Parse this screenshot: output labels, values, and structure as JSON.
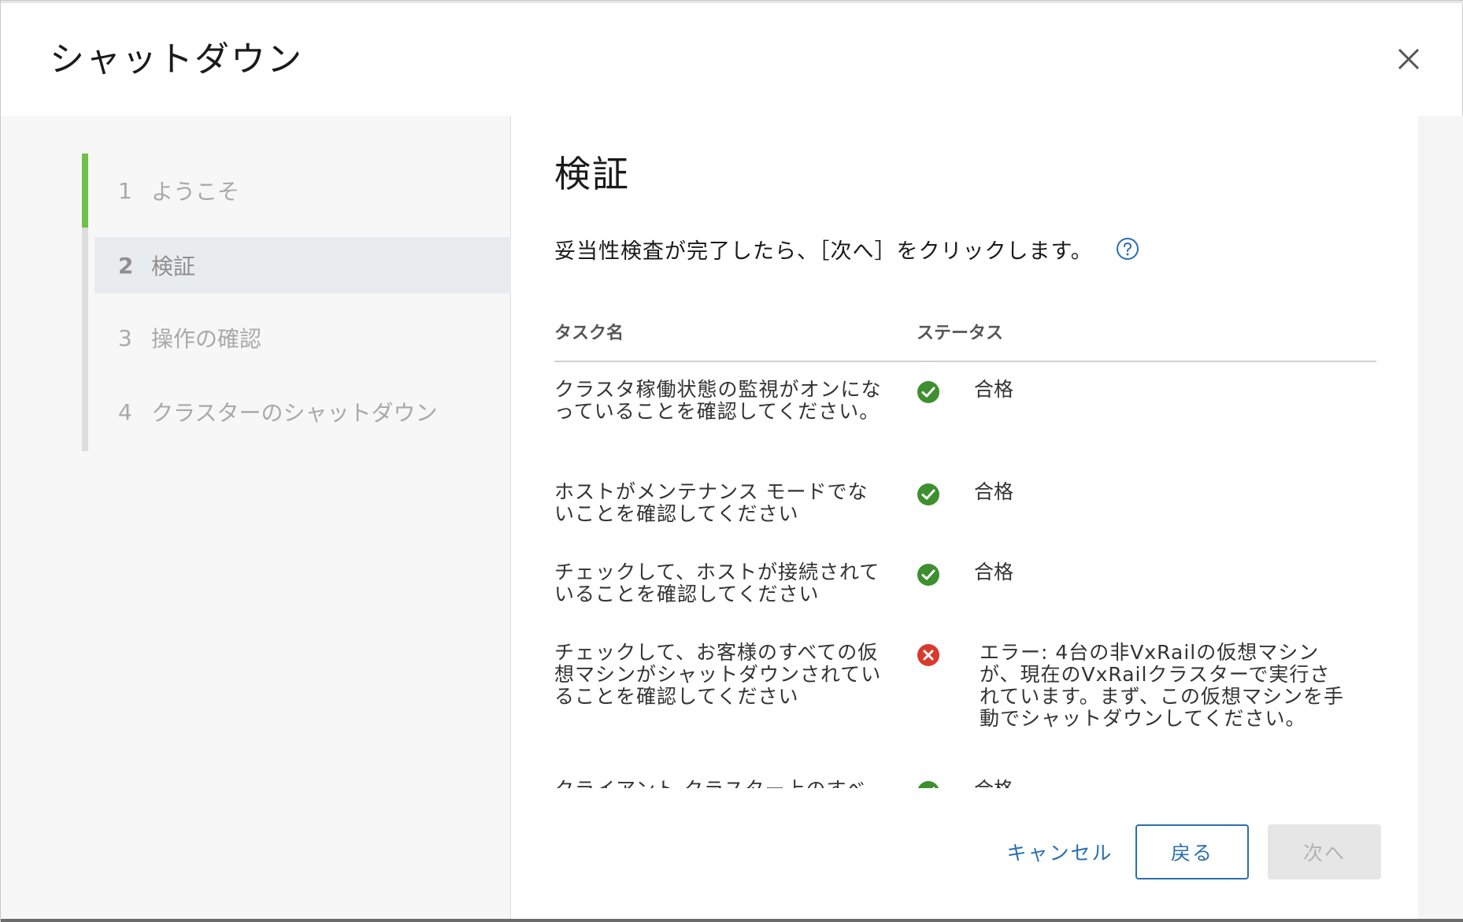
{
  "dialog": {
    "title": "シャットダウン",
    "close_icon": "close-icon"
  },
  "steps": [
    {
      "number": "1",
      "label": "ようこそ",
      "state": "completed"
    },
    {
      "number": "2",
      "label": "検証",
      "state": "current"
    },
    {
      "number": "3",
      "label": "操作の確認",
      "state": "upcoming"
    },
    {
      "number": "4",
      "label": "クラスターのシャットダウン",
      "state": "upcoming"
    }
  ],
  "main": {
    "heading": "検証",
    "instruction": "妥当性検査が完了したら、［次へ］をクリックします。",
    "help_icon": "help-circle-icon"
  },
  "table": {
    "headers": {
      "task": "タスク名",
      "status": "ステータス"
    },
    "rows": [
      {
        "task": "クラスタ稼働状態の監視がオンになっていることを確認してください。",
        "status": "合格",
        "status_icon": "check-circle-icon"
      },
      {
        "task": "ホストがメンテナンス モードでないことを確認してください",
        "status": "合格",
        "status_icon": "check-circle-icon"
      },
      {
        "task": "チェックして、ホストが接続されていることを確認してください",
        "status": "合格",
        "status_icon": "check-circle-icon"
      },
      {
        "task": "チェックして、お客様のすべての仮想マシンがシャットダウンされていることを確認してください",
        "status": "エラー: 4台の非VxRailの仮想マシンが、現在のVxRailクラスターで実行されています。まず、この仮想マシンを手動でシャットダウンしてください。",
        "status_icon": "error-circle-icon"
      },
      {
        "task": "クライアント クラスター上のすべ",
        "status": "合格",
        "status_icon": "check-circle-icon"
      }
    ]
  },
  "footer": {
    "cancel_label": "キャンセル",
    "back_label": "戻る",
    "next_label": "次へ"
  },
  "colors": {
    "accent_green": "#6fbf4a",
    "pass_green": "#3e8f2f",
    "error_red": "#d83a2b",
    "link_blue": "#2a6fae"
  }
}
